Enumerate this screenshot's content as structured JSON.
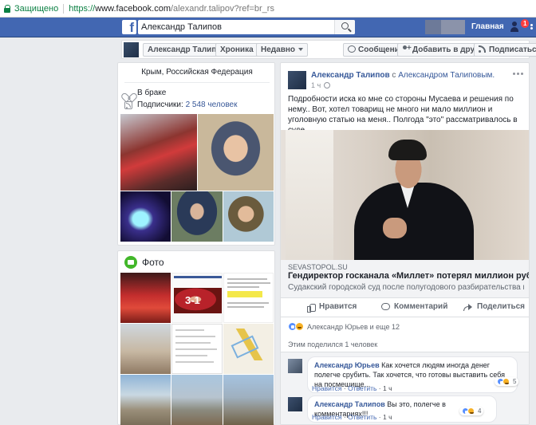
{
  "browser": {
    "secure_label": "Защищено",
    "url_scheme": "https://",
    "url_host": "www.facebook.com",
    "url_path": "/alexandr.talipov?ref=br_rs"
  },
  "fb_header": {
    "logo": "f",
    "search_value": "Александр Талипов",
    "home_label": "Главная",
    "friends_badge": "1",
    "brand_color": "#4267b2"
  },
  "profile_nav": {
    "name": "Александр Талипов",
    "timeline_label": "Хроника",
    "recent_label": "Недавно",
    "message_label": "Сообщение",
    "add_friend_label": "Добавить в друзья",
    "follow_label": "Подписаться"
  },
  "intro": {
    "location": "Крым, Российская Федерация",
    "relationship": "В браке",
    "followers_prefix": "Подписчики:",
    "followers_count": "2 548 человек"
  },
  "photos": {
    "title": "Фото",
    "score_text": "3-1"
  },
  "post": {
    "author": "Александр Талипов",
    "with_prefix": "с",
    "coauthor": "Александром Талиповым.",
    "time": "1 ч",
    "text": "Подробности иска ко мне со стороны Мусаева и решения по нему.. Вот, хотел товарищ не много ни мало миллион и уголовную статью на меня.. Полгода \"это\" рассматривалось в суде..",
    "link_source": "SEVASTOPOL.SU",
    "link_title": "Гендиректор госканала «Миллет» потерял миллион рублей",
    "link_desc": "Судакский городской суд после полугодового разбирательства вынес...",
    "like_label": "Нравится",
    "comment_label": "Комментарий",
    "share_label": "Поделиться",
    "reactions_text": "Александр Юрьев и еще 12",
    "shares_text": "Этим поделился 1 человек"
  },
  "comments": [
    {
      "author": "Александр Юрьев",
      "text": "Как хочется людям иногда денег полегче срубить. Так хочется, что готовы выставить себя на посмешище...",
      "like": "Нравится",
      "reply": "Ответить",
      "time": "1 ч",
      "reactions": "5"
    },
    {
      "author": "Александр Талипов",
      "text": "Вы это, полегче в комментариях!!!",
      "like": "Нравится",
      "reply": "Ответить",
      "time": "1 ч",
      "reactions": "4"
    }
  ]
}
